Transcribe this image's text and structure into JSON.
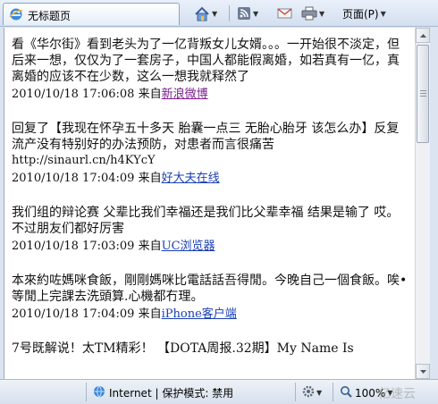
{
  "browser": {
    "tab_title": "无标题页",
    "page_menu_label": "页面(P)"
  },
  "posts": [
    {
      "text": "看《华尔街》看到老头为了一亿背叛女儿女婿。。。一开始很不淡定，但后来一想，仅仅为了一套房子，中国人都能假离婚，如若真有一亿，真离婚的应该不在少数，这么一想我就释然了",
      "url": "",
      "timestamp": "2010/10/18 17:06:08",
      "source_prefix": "来自",
      "source": "新浪微博",
      "visited": true
    },
    {
      "text": "回复了【我现在怀孕五十多天 胎囊一点三 无胎心胎牙 该怎么办】反复流产没有特别好的办法预防，对患者而言很痛苦",
      "url": "http://sinaurl.cn/h4KYcY",
      "timestamp": "2010/10/18 17:04:09",
      "source_prefix": "来自",
      "source": "好大夫在线",
      "visited": false
    },
    {
      "text": "我们组的辩论赛 父辈比我们幸福还是我们比父辈幸福 结果是输了 哎。不过朋友们都好厉害",
      "url": "",
      "timestamp": "2010/10/18 17:03:09",
      "source_prefix": "来自",
      "source": "UC浏览器",
      "visited": false
    },
    {
      "text": "本來約咗媽咪食飯，剛剛媽咪比電話話吾得閒。今晚自己一個食飯。唉•等閒上完課去洗頭算.心機都冇理。",
      "url": "",
      "timestamp": "2010/10/18 17:04:09",
      "source_prefix": "来自",
      "source": "iPhone客户端",
      "visited": false
    },
    {
      "text": "7号既解说！太TM精彩！ 【DOTA周报.32期】My Name Is",
      "url": "",
      "timestamp": "",
      "source_prefix": "",
      "source": "",
      "visited": false
    }
  ],
  "statusbar": {
    "zone": "Internet | 保护模式: 禁用",
    "zoom": "100%"
  },
  "watermark": "亿速云"
}
